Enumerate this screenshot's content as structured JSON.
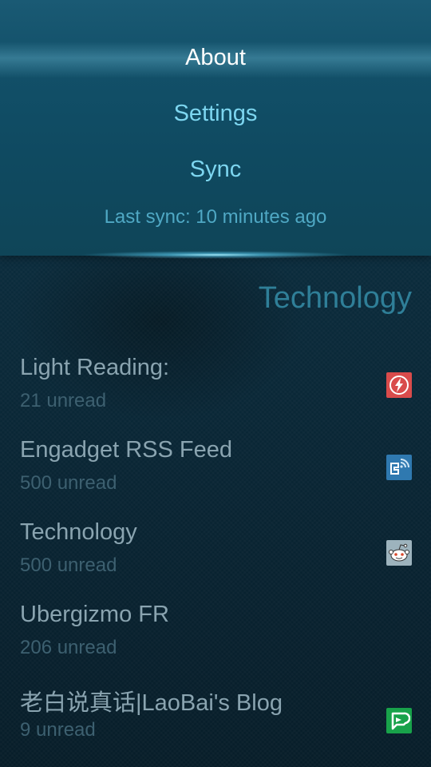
{
  "pulley_menu": {
    "items": [
      {
        "label": "About",
        "active": true
      },
      {
        "label": "Settings",
        "active": false
      },
      {
        "label": "Sync",
        "active": false
      }
    ],
    "last_sync": "Last sync: 10 minutes ago"
  },
  "page": {
    "title": "Technology"
  },
  "feeds": [
    {
      "title": "Light Reading:",
      "unread": "21 unread",
      "icon": "lightning-icon"
    },
    {
      "title": "Engadget RSS Feed",
      "unread": "500 unread",
      "icon": "rss-feed-icon"
    },
    {
      "title": "Technology",
      "unread": "500 unread",
      "icon": "reddit-alien-icon"
    },
    {
      "title": "Ubergizmo FR",
      "unread": "206 unread",
      "icon": null
    },
    {
      "title": "老白说真话|LaoBai's Blog",
      "unread": "9 unread",
      "icon": "chat-bubble-icon"
    }
  ],
  "colors": {
    "accent": "#7dd6f0",
    "active_menu": "#ffffff",
    "header": "#2f7f98",
    "feed_title": "#8aa4b0",
    "feed_count": "#3d6070"
  }
}
